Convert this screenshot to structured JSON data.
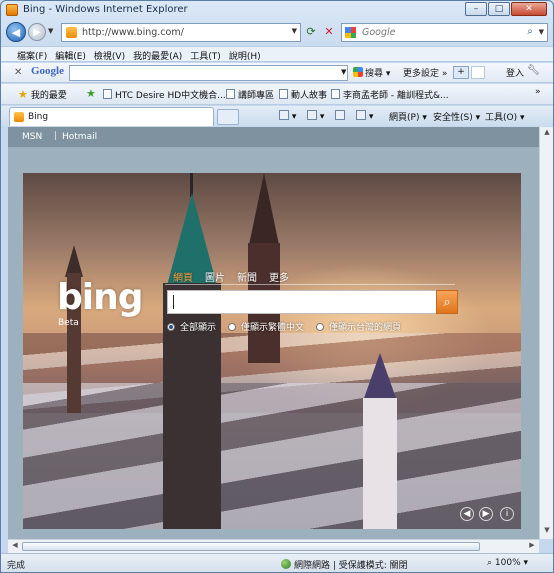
{
  "window": {
    "title": "Bing - Windows Internet Explorer",
    "controls": {
      "minimize": "–",
      "maximize": "□",
      "close": "✕"
    }
  },
  "address_bar": {
    "url": "http://www.bing.com/",
    "search_placeholder": "Google"
  },
  "menu": [
    "檔案(F)",
    "編輯(E)",
    "檢視(V)",
    "我的最愛(A)",
    "工具(T)",
    "說明(H)"
  ],
  "google_toolbar": {
    "logo": "Google",
    "search_label": "搜尋",
    "more_label": "更多設定 »",
    "login_label": "登入"
  },
  "favorites": {
    "label": "我的最愛",
    "items": [
      "HTC Desire HD中文機合...",
      "講師專區",
      "動人故事",
      "李商孟老師 - 離訓程式&..."
    ],
    "more": "»"
  },
  "tab": {
    "label": "Bing"
  },
  "command_bar": {
    "page": "網頁(P)",
    "safety": "安全性(S)",
    "tools": "工具(O)"
  },
  "page": {
    "top_links": [
      "MSN",
      "Hotmail"
    ],
    "logo": "bing",
    "beta": "Beta",
    "scopes": [
      "網頁",
      "圖片",
      "新聞",
      "更多"
    ],
    "active_scope": "網頁",
    "search_value": "",
    "radio_options": [
      "全部顯示",
      "僅顯示繁體中文",
      "僅顯示台灣的網頁"
    ],
    "radio_selected": "全部顯示"
  },
  "status_bar": {
    "status": "完成",
    "zone": "網際網路 | 受保護模式: 關閉",
    "zoom": "100%"
  },
  "colors": {
    "accent_orange": "#f7a23a",
    "ie_blue": "#1d63b8"
  }
}
